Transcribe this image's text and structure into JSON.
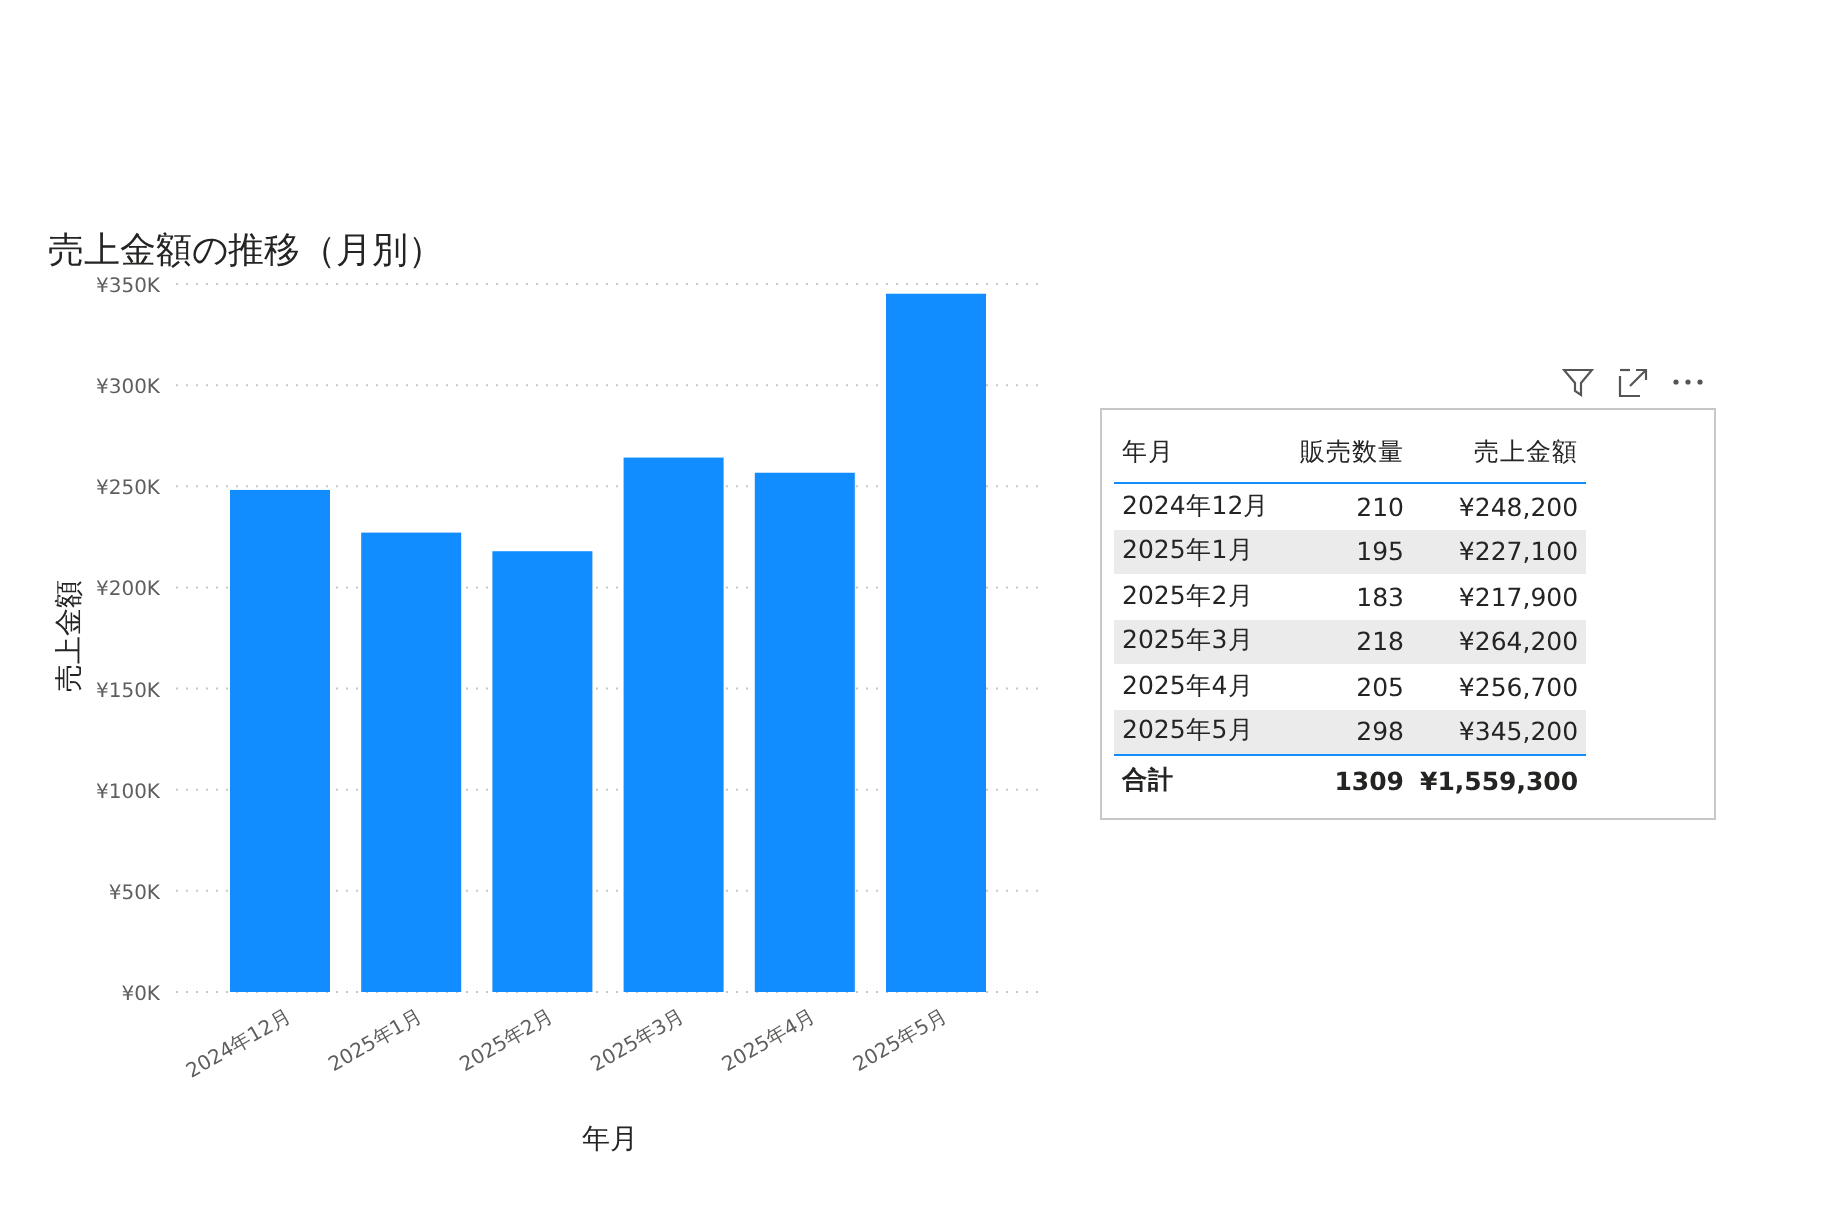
{
  "chart": {
    "title": "売上金額の推移（月別）",
    "chart_data": {
      "type": "bar",
      "xlabel": "年月",
      "ylabel": "売上金額",
      "categories": [
        "2024年12月",
        "2025年1月",
        "2025年2月",
        "2025年3月",
        "2025年4月",
        "2025年5月"
      ],
      "grid": true,
      "series": [
        {
          "color": "#118dff",
          "values": [
            248200,
            227100,
            217900,
            264200,
            256700,
            345200
          ]
        }
      ],
      "ylim": [
        0,
        350000
      ],
      "yticks": [
        {
          "value": 0,
          "label": "¥0K"
        },
        {
          "value": 50000,
          "label": "¥50K"
        },
        {
          "value": 100000,
          "label": "¥100K"
        },
        {
          "value": 150000,
          "label": "¥150K"
        },
        {
          "value": 200000,
          "label": "¥200K"
        },
        {
          "value": 250000,
          "label": "¥250K"
        },
        {
          "value": 300000,
          "label": "¥300K"
        },
        {
          "value": 350000,
          "label": "¥350K"
        }
      ]
    }
  },
  "table": {
    "columns": [
      "年月",
      "販売数量",
      "売上金額"
    ],
    "rows": [
      [
        "2024年12月",
        "210",
        "¥248,200"
      ],
      [
        "2025年1月",
        "195",
        "¥227,100"
      ],
      [
        "2025年2月",
        "183",
        "¥217,900"
      ],
      [
        "2025年3月",
        "218",
        "¥264,200"
      ],
      [
        "2025年4月",
        "205",
        "¥256,700"
      ],
      [
        "2025年5月",
        "298",
        "¥345,200"
      ]
    ],
    "total": [
      "合計",
      "1309",
      "¥1,559,300"
    ]
  }
}
